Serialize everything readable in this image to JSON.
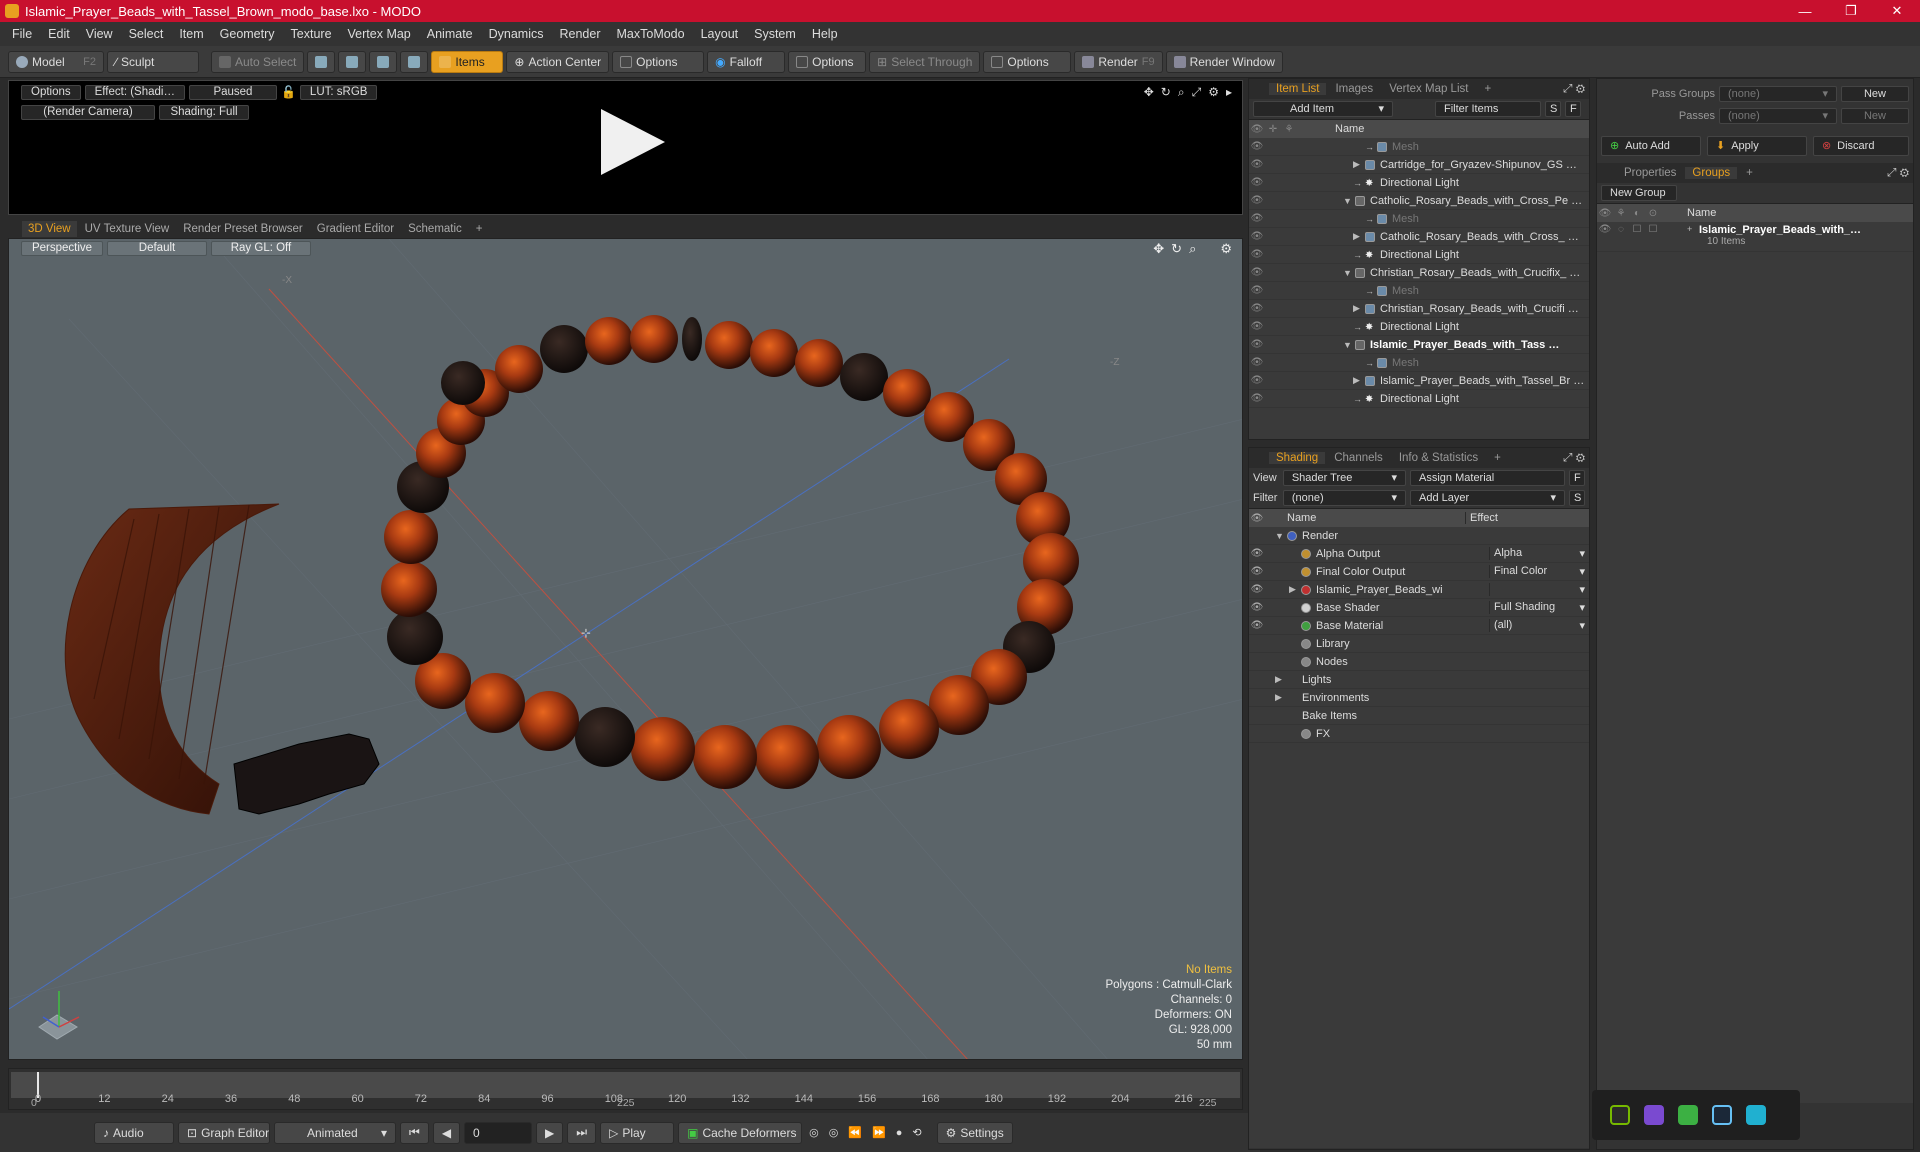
{
  "window": {
    "title": "Islamic_Prayer_Beads_with_Tassel_Brown_modo_base.lxo - MODO",
    "controls": [
      "—",
      "❐",
      "✕"
    ]
  },
  "menu": [
    "File",
    "Edit",
    "View",
    "Select",
    "Item",
    "Geometry",
    "Texture",
    "Vertex Map",
    "Animate",
    "Dynamics",
    "Render",
    "MaxToModo",
    "Layout",
    "System",
    "Help"
  ],
  "toolbar": {
    "model": "Model",
    "model_key": "F2",
    "sculpt": "Sculpt",
    "auto_select": "Auto Select",
    "items": "Items",
    "action_center": "Action Center",
    "options1": "Options",
    "falloff": "Falloff",
    "options2": "Options",
    "select_through": "Select Through",
    "options3": "Options",
    "render": "Render",
    "render_key": "F9",
    "render_window": "Render Window"
  },
  "preview": {
    "options": "Options",
    "effect": "Effect: (Shadi…",
    "paused": "Paused",
    "lut": "LUT: sRGB",
    "camera": "(Render Camera)",
    "shading": "Shading: Full"
  },
  "viewtabs": [
    "3D View",
    "UV Texture View",
    "Render Preset Browser",
    "Gradient Editor",
    "Schematic",
    "+"
  ],
  "viewport": {
    "projection": "Perspective",
    "style": "Default",
    "raygl": "Ray GL: Off",
    "axis_neg_x": "-X",
    "axis_neg_z": "-Z",
    "hud": {
      "items": "No Items",
      "polygons": "Polygons : Catmull-Clark",
      "channels": "Channels: 0",
      "deformers": "Deformers: ON",
      "gl": "GL: 928,000",
      "scale": "50 mm"
    }
  },
  "timeline": {
    "ticks": [
      "0",
      "12",
      "24",
      "36",
      "48",
      "60",
      "72",
      "84",
      "96",
      "108",
      "120",
      "132",
      "144",
      "156",
      "168",
      "180",
      "192",
      "204",
      "216"
    ],
    "sub_start": "0",
    "sub_mid": "225",
    "sub_end": "225"
  },
  "transport": {
    "audio": "Audio",
    "graph_editor": "Graph Editor",
    "animated": "Animated",
    "frame": "0",
    "play": "Play",
    "cache": "Cache Deformers",
    "settings": "Settings"
  },
  "itemlist": {
    "tabs": [
      "Item List",
      "Images",
      "Vertex Map List",
      "+"
    ],
    "add_item": "Add Item",
    "filter": "Filter Items",
    "s": "S",
    "f": "F",
    "col_name": "Name",
    "rows": [
      {
        "label": "Mesh",
        "indent": 2,
        "type": "mesh",
        "dim": true
      },
      {
        "label": "Cartridge_for_Gryazev-Shipunov_GS …",
        "indent": 1,
        "type": "mesh",
        "arrow": "▶"
      },
      {
        "label": "Directional Light",
        "indent": 1,
        "type": "light"
      },
      {
        "label": "Catholic_Rosary_Beads_with_Cross_Pe …",
        "indent": 0,
        "type": "group",
        "arrow": "▼"
      },
      {
        "label": "Mesh",
        "indent": 2,
        "type": "mesh",
        "dim": true
      },
      {
        "label": "Catholic_Rosary_Beads_with_Cross_ …",
        "indent": 1,
        "type": "mesh",
        "arrow": "▶"
      },
      {
        "label": "Directional Light",
        "indent": 1,
        "type": "light"
      },
      {
        "label": "Christian_Rosary_Beads_with_Crucifix_ …",
        "indent": 0,
        "type": "group",
        "arrow": "▼"
      },
      {
        "label": "Mesh",
        "indent": 2,
        "type": "mesh",
        "dim": true
      },
      {
        "label": "Christian_Rosary_Beads_with_Crucifi …",
        "indent": 1,
        "type": "mesh",
        "arrow": "▶"
      },
      {
        "label": "Directional Light",
        "indent": 1,
        "type": "light"
      },
      {
        "label": "Islamic_Prayer_Beads_with_Tass …",
        "indent": 0,
        "type": "group",
        "arrow": "▼",
        "bold": true
      },
      {
        "label": "Mesh",
        "indent": 2,
        "type": "mesh",
        "dim": true
      },
      {
        "label": "Islamic_Prayer_Beads_with_Tassel_Br …",
        "indent": 1,
        "type": "mesh",
        "arrow": "▶"
      },
      {
        "label": "Directional Light",
        "indent": 1,
        "type": "light"
      }
    ]
  },
  "shading": {
    "tabs": [
      "Shading",
      "Channels",
      "Info & Statistics",
      "+"
    ],
    "view_label": "View",
    "view_value": "Shader Tree",
    "assign": "Assign Material",
    "filter_label": "Filter",
    "filter_value": "(none)",
    "add_layer": "Add Layer",
    "col_name": "Name",
    "col_effect": "Effect",
    "rows": [
      {
        "label": "Render",
        "effect": "",
        "indent": 0,
        "arrow": "▼",
        "eye": false,
        "icon": "#4060c0"
      },
      {
        "label": "Alpha Output",
        "effect": "Alpha",
        "indent": 1,
        "eye": true,
        "icon": "#c09030"
      },
      {
        "label": "Final Color Output",
        "effect": "Final Color",
        "indent": 1,
        "eye": true,
        "icon": "#c09030"
      },
      {
        "label": "Islamic_Prayer_Beads_wit …",
        "effect": "",
        "indent": 1,
        "arrow": "▶",
        "eye": true,
        "icon": "#c03030"
      },
      {
        "label": "Base Shader",
        "effect": "Full Shading",
        "indent": 1,
        "eye": true,
        "icon": "#d0d0d0"
      },
      {
        "label": "Base Material",
        "effect": "(all)",
        "indent": 1,
        "eye": true,
        "icon": "#40a040"
      },
      {
        "label": "Library",
        "effect": "",
        "indent": 1,
        "eye": false,
        "icon": "#888888"
      },
      {
        "label": "Nodes",
        "effect": "",
        "indent": 1,
        "eye": false,
        "icon": "#888888"
      },
      {
        "label": "Lights",
        "effect": "",
        "indent": 0,
        "arrow": "▶",
        "eye": false,
        "icon": ""
      },
      {
        "label": "Environments",
        "effect": "",
        "indent": 0,
        "arrow": "▶",
        "eye": false,
        "icon": ""
      },
      {
        "label": "Bake Items",
        "effect": "",
        "indent": 0,
        "eye": false,
        "icon": ""
      },
      {
        "label": "FX",
        "effect": "",
        "indent": 1,
        "eye": false,
        "icon": "#888888"
      }
    ]
  },
  "groups": {
    "pass_groups": "Pass Groups",
    "pass_value": "(none)",
    "new": "New",
    "passes": "Passes",
    "passes_value": "(none)",
    "new2": "New",
    "auto_add": "Auto Add",
    "apply": "Apply",
    "discard": "Discard",
    "tabs": [
      "Properties",
      "Groups",
      "+"
    ],
    "new_group": "New Group",
    "col_name": "Name",
    "group_name": "Islamic_Prayer_Beads_with_…",
    "group_count": "10 Items"
  },
  "colors": {
    "accent": "#e8a020",
    "titlebar": "#c8102e",
    "viewport": "#5b6469"
  }
}
